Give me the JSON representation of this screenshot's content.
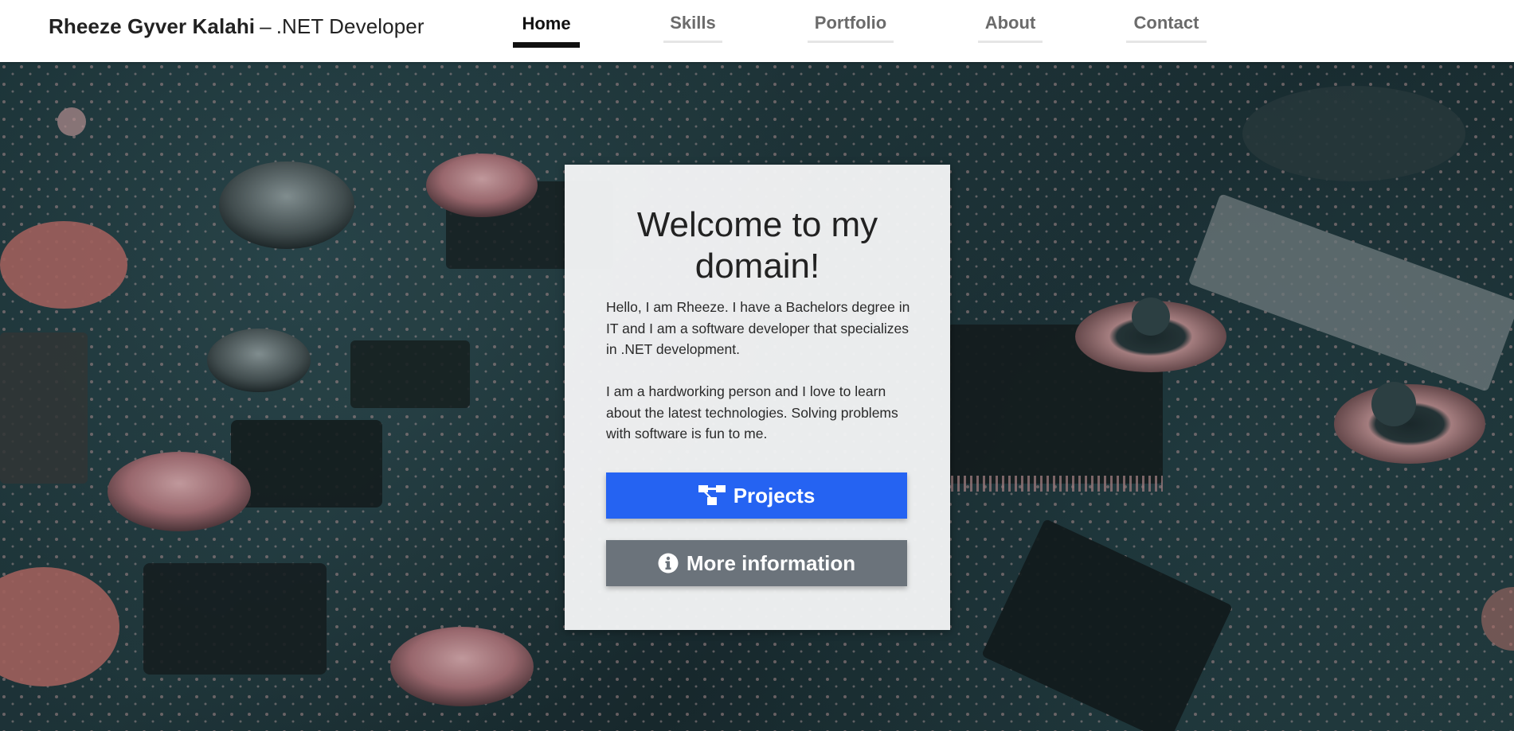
{
  "header": {
    "brand_name": "Rheeze Gyver Kalahi",
    "brand_separator": "–",
    "brand_role": ".NET Developer",
    "nav": [
      {
        "label": "Home",
        "active": true
      },
      {
        "label": "Skills",
        "active": false
      },
      {
        "label": "Portfolio",
        "active": false
      },
      {
        "label": "About",
        "active": false
      },
      {
        "label": "Contact",
        "active": false
      }
    ]
  },
  "hero": {
    "background_image": "circuit-board-photo"
  },
  "card": {
    "title": "Welcome to my domain!",
    "paragraph_1": "Hello, I am Rheeze. I have a Bachelors degree in IT and I am a software developer that specializes in .NET development.",
    "paragraph_2": "I am a hardworking person and I love to learn about the latest technologies. Solving problems with software is fun to me.",
    "projects_button": {
      "label": "Projects",
      "icon": "sitemap-icon"
    },
    "more_button": {
      "label": "More information",
      "icon": "info-circle-icon"
    }
  },
  "colors": {
    "primary": "#2563f2",
    "secondary": "#6b737b",
    "nav_active": "#111111",
    "nav_inactive": "#6b6b6b",
    "header_bg": "#ffffff"
  }
}
